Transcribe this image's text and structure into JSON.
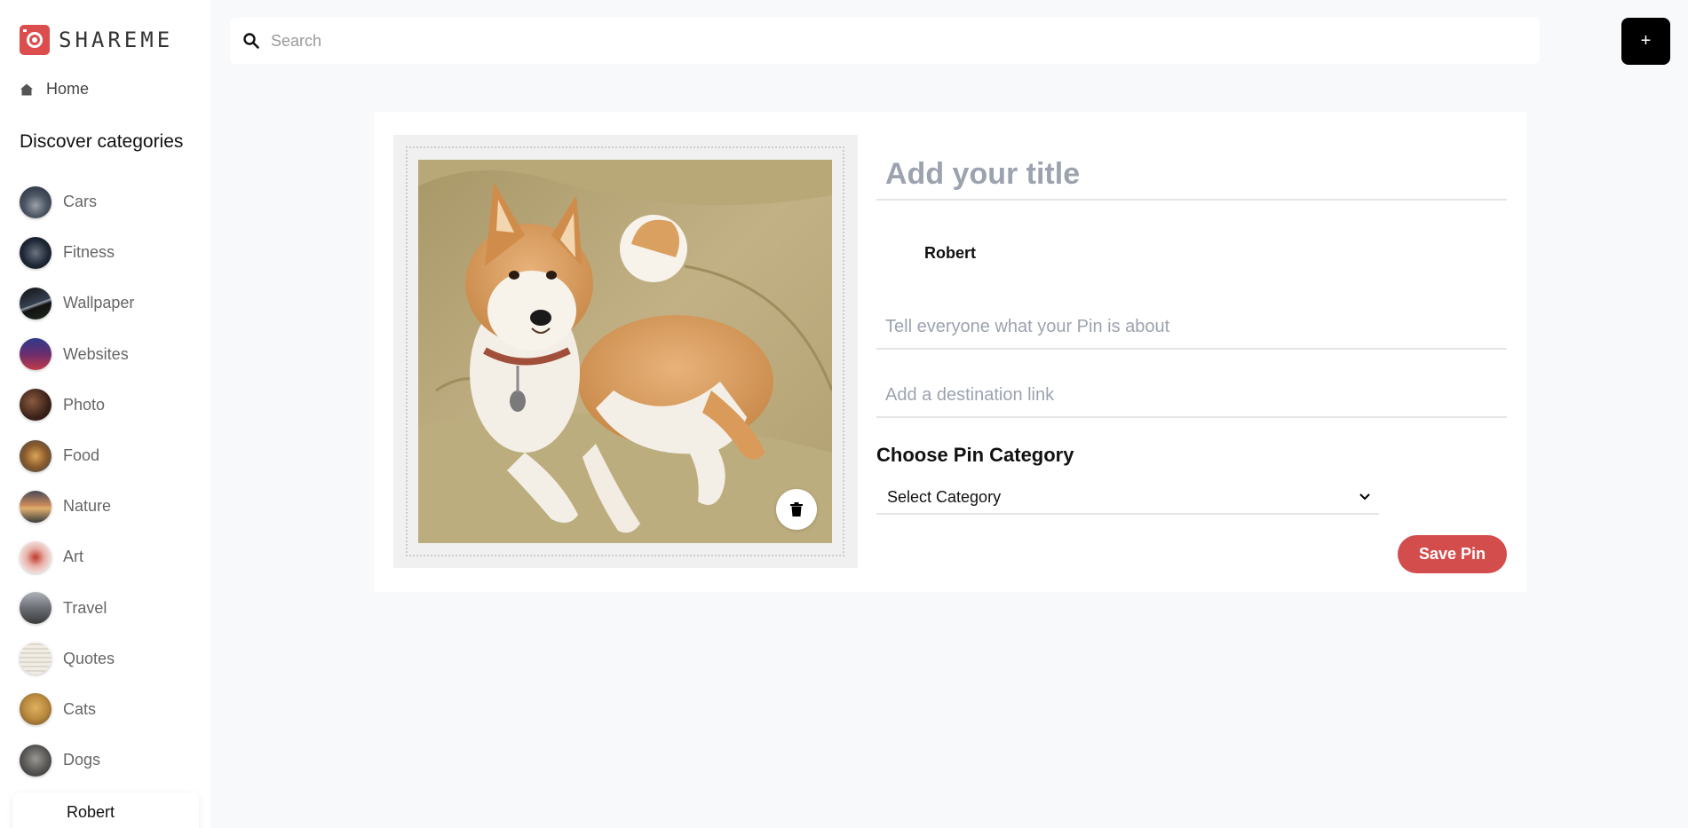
{
  "app": {
    "logo_text": "SHAREME"
  },
  "sidebar": {
    "home_label": "Home",
    "discover_title": "Discover categories",
    "categories": [
      {
        "label": "Cars",
        "color": "#4b5563"
      },
      {
        "label": "Fitness",
        "color": "#1f2937"
      },
      {
        "label": "Wallpaper",
        "color": "#374151"
      },
      {
        "label": "Websites",
        "color": "#3b4a8c"
      },
      {
        "label": "Photo",
        "color": "#4a2e22"
      },
      {
        "label": "Food",
        "color": "#7c5a2a"
      },
      {
        "label": "Nature",
        "color": "#8a6a4a"
      },
      {
        "label": "Art",
        "color": "#d9a09a"
      },
      {
        "label": "Travel",
        "color": "#6b6f75"
      },
      {
        "label": "Quotes",
        "color": "#ede9e0"
      },
      {
        "label": "Cats",
        "color": "#b98a3e"
      },
      {
        "label": "Dogs",
        "color": "#5b5a58"
      }
    ],
    "user_name": "Robert"
  },
  "header": {
    "search_placeholder": "Search",
    "add_label": "+"
  },
  "form": {
    "title_placeholder": "Add your title",
    "author_name": "Robert",
    "about_placeholder": "Tell everyone what your Pin is about",
    "destination_placeholder": "Add a destination link",
    "category_heading": "Choose Pin Category",
    "category_selected": "Select Category",
    "save_label": "Save Pin"
  },
  "colors": {
    "accent": "#d44d4d",
    "background": "#f8f9fb"
  }
}
